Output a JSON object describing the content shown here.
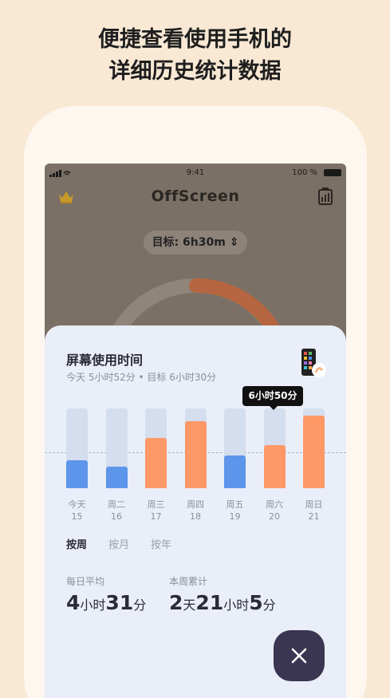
{
  "headline": [
    "便捷查看使用手机的",
    "详细历史统计数据"
  ],
  "status_bar": {
    "time": "9:41",
    "battery": "100 %"
  },
  "app": {
    "title": "OffScreen",
    "goal_pill": "目标: 6h30m ⇕"
  },
  "sheet": {
    "title": "屏幕使用时间",
    "subtitle": "今天 5小时52分 • 目标 6小时30分",
    "tooltip": "6小时50分"
  },
  "chart_data": {
    "type": "bar",
    "categories": [
      "今天",
      "周二",
      "周三",
      "周四",
      "周五",
      "周六",
      "周日"
    ],
    "dates": [
      "15",
      "16",
      "17",
      "18",
      "19",
      "20",
      "21"
    ],
    "values": [
      0.35,
      0.27,
      0.63,
      0.84,
      0.41,
      0.54,
      0.91
    ],
    "over_goal": [
      false,
      false,
      true,
      true,
      false,
      true,
      true
    ],
    "goal_level": 0.45,
    "colors": {
      "under": "#5d95ea",
      "over": "#fe9867",
      "track": "#d4deee"
    }
  },
  "tabs": [
    "按周",
    "按月",
    "按年"
  ],
  "stats": {
    "daily_avg": {
      "label": "每日平均",
      "v1": "4",
      "u1": "小时",
      "v2": "31",
      "u2": "分"
    },
    "week_total": {
      "label": "本周累计",
      "v1": "2",
      "u1": "天",
      "v2": "21",
      "u2": "小时",
      "v3": "5",
      "u3": "分"
    }
  },
  "close_icon": "close-icon"
}
